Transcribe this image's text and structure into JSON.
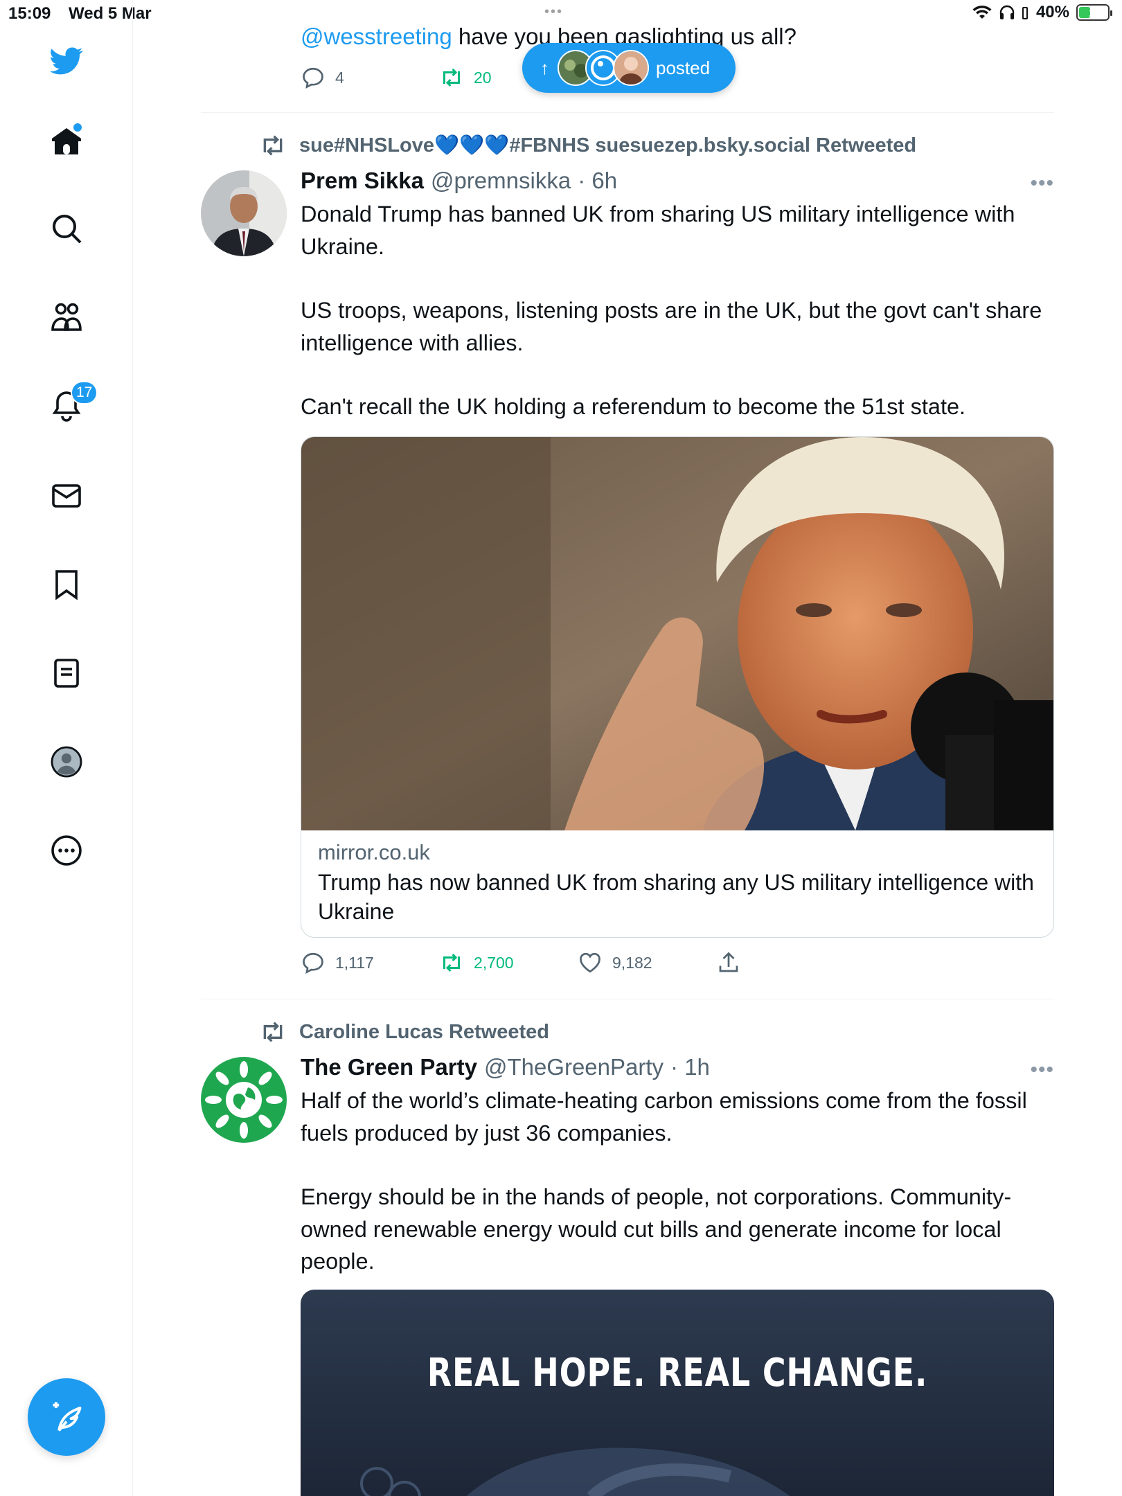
{
  "status_bar": {
    "time": "15:09",
    "date": "Wed 5 Mar",
    "dots": "•••",
    "battery": "40%"
  },
  "nav": {
    "notifications_badge": "17"
  },
  "top_tweet": {
    "mention": "@wesstreeting",
    "text": " have you been gaslighting us all?",
    "replies": "4",
    "retweets": "20"
  },
  "new_posts_pill": {
    "arrow": "↑",
    "label": "posted"
  },
  "tweet1": {
    "retweeted_by": "sue#NHSLove💙💙💙#FBNHS suesuezep.bsky.social Retweeted",
    "name": "Prem Sikka",
    "handle": "@premnsikka",
    "time": "· 6h",
    "more": "•••",
    "paragraphs": [
      "Donald Trump has banned UK from sharing US military intelligence with Ukraine.",
      "US troops, weapons, listening posts are in the UK, but the govt can't share intelligence with allies.",
      "Can't recall the UK holding a referendum to become the 51st state."
    ],
    "card_domain": "mirror.co.uk",
    "card_title": "Trump has now banned UK from sharing any US military intelligence with Ukraine",
    "replies": "1,117",
    "retweets": "2,700",
    "likes": "9,182"
  },
  "tweet2": {
    "retweeted_by": "Caroline Lucas Retweeted",
    "name": "The Green Party",
    "handle": "@TheGreenParty",
    "time": "· 1h",
    "more": "•••",
    "paragraphs": [
      "Half of the world’s climate-heating carbon emissions come from the fossil fuels produced by just 36 companies.",
      "Energy should be in the hands of people, not corporations. Community-owned renewable energy would cut bills and generate income for local people."
    ],
    "media_text": "REAL HOPE. REAL CHANGE."
  },
  "colors": {
    "accent": "#1d9bf0",
    "retweet_green": "#00ba7c",
    "secondary_text": "#536471",
    "green_party": "#1fa750"
  }
}
